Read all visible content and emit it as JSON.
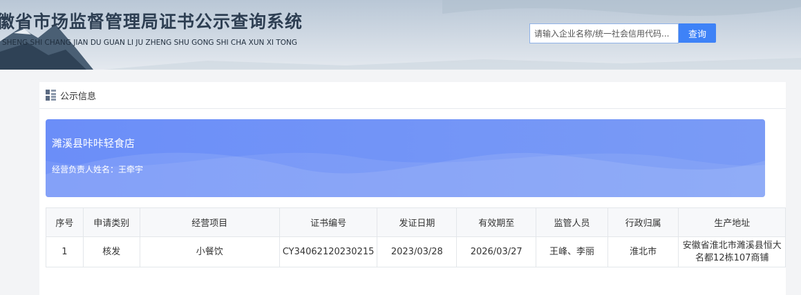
{
  "header": {
    "title": "徽省市场监督管理局证书公示查询系统",
    "subtitle": "SHENG SHI CHANG JIAN DU GUAN LI JU ZHENG SHU GONG SHI CHA XUN XI TONG"
  },
  "search": {
    "placeholder": "请输入企业名称/统一社会信用代码...",
    "button_label": "查询"
  },
  "panel": {
    "title": "公示信息"
  },
  "company": {
    "name": "濉溪县咔咔轻食店",
    "owner_label": "经营负责人姓名：王牵宇"
  },
  "table": {
    "columns": [
      "序号",
      "申请类别",
      "经营项目",
      "证书编号",
      "发证日期",
      "有效期至",
      "监管人员",
      "行政归属",
      "生产地址"
    ],
    "rows": [
      [
        "1",
        "核发",
        "小餐饮",
        "CY34062120230215",
        "2023/03/28",
        "2026/03/27",
        "王峰、李丽",
        "淮北市",
        "安徽省淮北市濉溪县恒大名都12栋107商铺"
      ]
    ]
  },
  "colors": {
    "accent": "#3e82f7",
    "card_bg": "#6b8ef8"
  }
}
